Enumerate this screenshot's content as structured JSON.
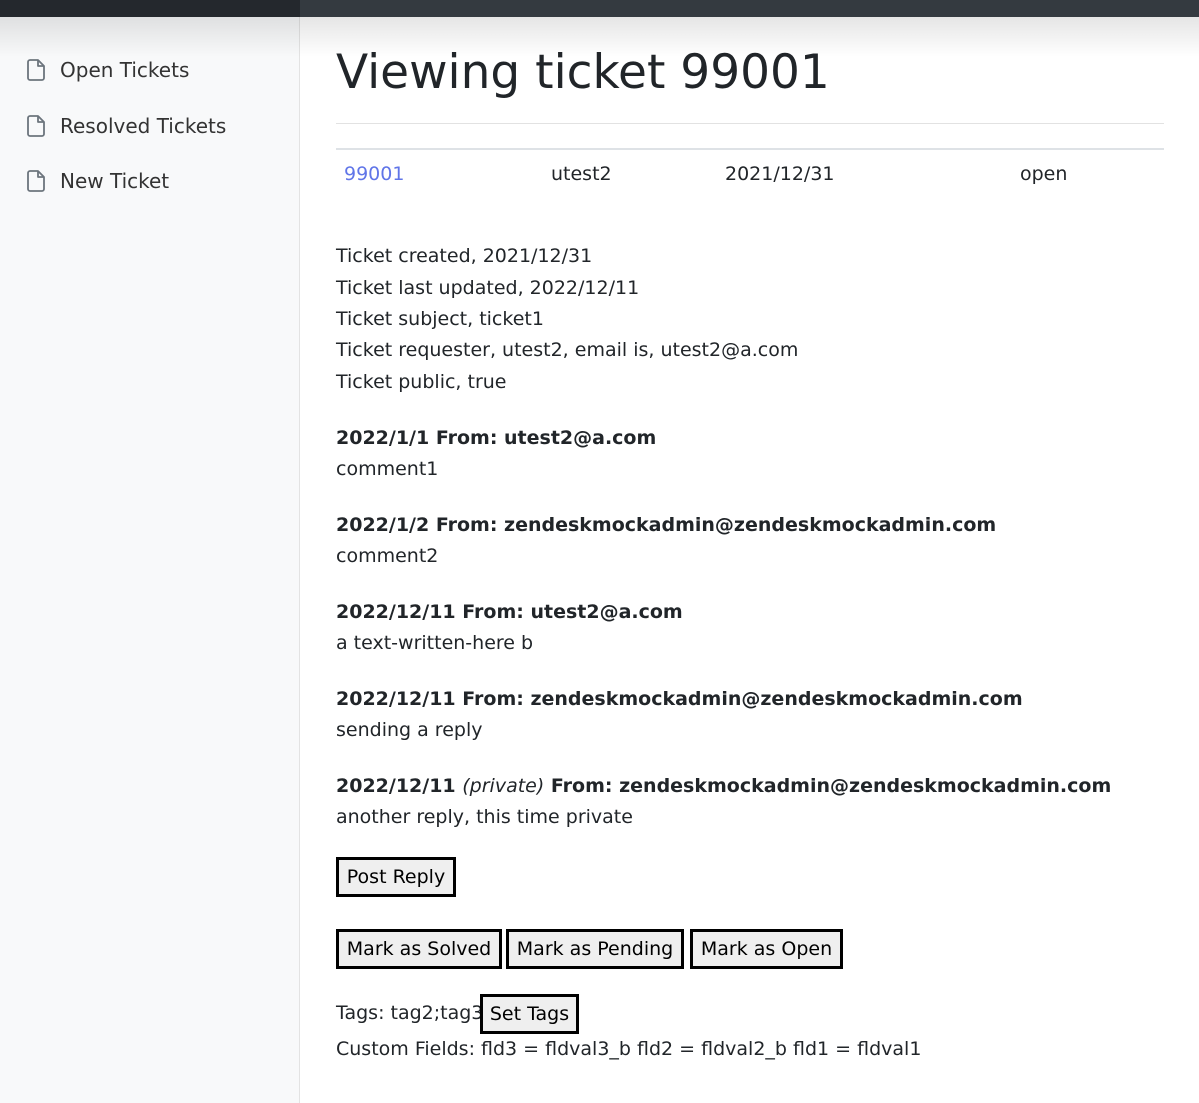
{
  "sidebar": {
    "items": [
      {
        "label": "Open Tickets",
        "icon": "file-icon"
      },
      {
        "label": "Resolved Tickets",
        "icon": "file-icon"
      },
      {
        "label": "New Ticket",
        "icon": "file-icon"
      }
    ]
  },
  "page": {
    "title": "Viewing ticket 99001"
  },
  "ticket_row": {
    "id": "99001",
    "requester": "utest2",
    "date": "2021/12/31",
    "status": "open"
  },
  "details": [
    "Ticket created, 2021/12/31",
    "Ticket last updated, 2022/12/11",
    "Ticket subject, ticket1",
    "Ticket requester, utest2, email is, utest2@a.com",
    "Ticket public, true"
  ],
  "comments": [
    {
      "date": "2022/1/1",
      "private": "",
      "from": "From: utest2@a.com",
      "body": "comment1"
    },
    {
      "date": "2022/1/2",
      "private": "",
      "from": "From: zendeskmockadmin@zendeskmockadmin.com",
      "body": "comment2"
    },
    {
      "date": "2022/12/11",
      "private": "",
      "from": "From: utest2@a.com",
      "body": "a text-written-here b"
    },
    {
      "date": "2022/12/11",
      "private": "",
      "from": "From: zendeskmockadmin@zendeskmockadmin.com",
      "body": "sending a reply"
    },
    {
      "date": "2022/12/11",
      "private": "(private)",
      "from": "From: zendeskmockadmin@zendeskmockadmin.com",
      "body": "another reply, this time private"
    }
  ],
  "buttons": {
    "post_reply": "Post Reply",
    "mark_solved": "Mark as Solved",
    "mark_pending": "Mark as Pending",
    "mark_open": "Mark as Open",
    "set_tags": "Set Tags"
  },
  "tags": {
    "label": "Tags: tag2;tag3"
  },
  "custom_fields": {
    "label": "Custom Fields: fld3 = fldval3_b fld2 = fldval2_b fld1 = fldval1"
  },
  "colors": {
    "link": "#6075e8",
    "topbar": "#343a40",
    "sidebar_bg": "#f8f9fa"
  }
}
